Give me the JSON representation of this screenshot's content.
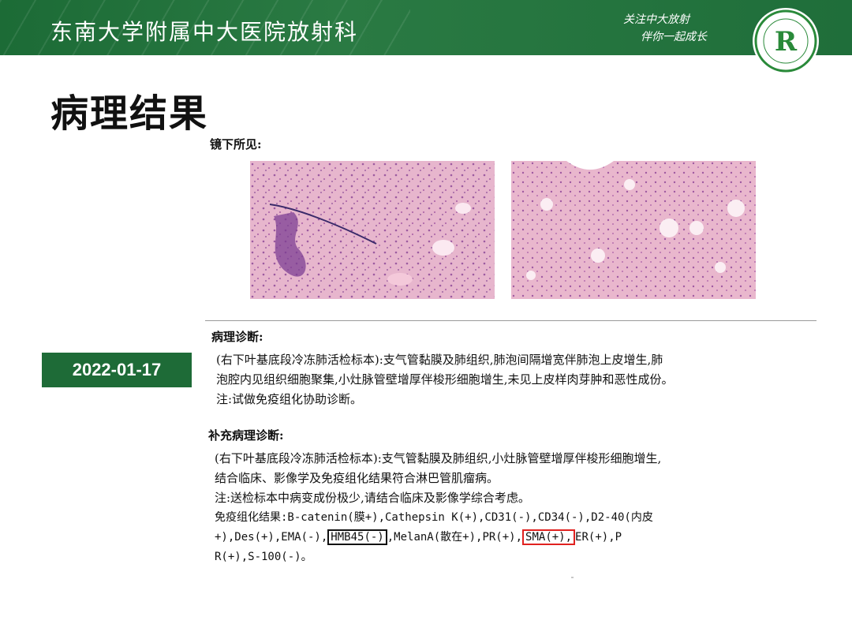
{
  "header": {
    "title": "东南大学附属中大医院放射科",
    "slogan_line1": "关注中大放射",
    "slogan_line2": "伴你一起成长",
    "logo_letter": "R",
    "colors": {
      "band": "#1e6b37",
      "text": "#ffffff"
    }
  },
  "page_title": "病理结果",
  "microscopy": {
    "label": "镜下所见:",
    "images": [
      "histology-image-left",
      "histology-image-right"
    ]
  },
  "date_badge": "2022-01-17",
  "diagnosis": {
    "title": "病理诊断:",
    "line1": "(右下叶基底段冷冻肺活检标本):支气管黏膜及肺组织,肺泡间隔增宽伴肺泡上皮增生,肺",
    "line2": "泡腔内见组织细胞聚集,小灶脉管壁增厚伴梭形细胞增生,未见上皮样肉芽肿和恶性成份。",
    "note": "注:试做免疫组化协助诊断。"
  },
  "supplementary": {
    "title": "补充病理诊断:",
    "line1": "(右下叶基底段冷冻肺活检标本):支气管黏膜及肺组织,小灶脉管壁增厚伴梭形细胞增生,",
    "line2": "结合临床、影像学及免疫组化结果符合淋巴管肌瘤病。",
    "note": "注:送检标本中病变成份极少,请结合临床及影像学综合考虑。",
    "ihc_line1": "免疫组化结果:B-catenin(膜+),Cathepsin K(+),CD31(-),CD34(-),D2-40(内皮",
    "ihc_line2_a": "+),Des(+),EMA(-),",
    "ihc_hmb45": "HMB45(-)",
    "ihc_line2_b": ",MelanA(散在+),PR(+),",
    "ihc_sma": "SMA(+),",
    "ihc_line2_c": "ER(+),P",
    "ihc_line3": "R(+),S-100(-)。",
    "highlight_colors": {
      "hmb45_box": "#111111",
      "sma_box": "#e0211f"
    }
  }
}
